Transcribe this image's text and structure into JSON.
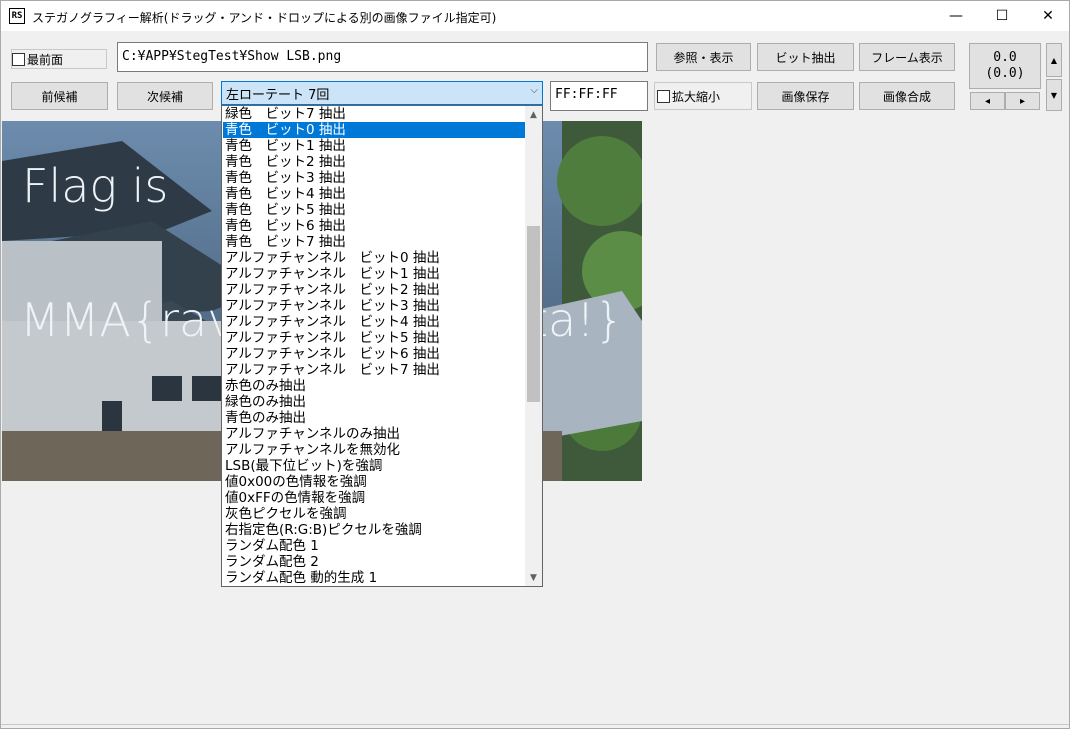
{
  "window": {
    "app_icon_text": "RS",
    "title": "ステガノグラフィー解析(ドラッグ・アンド・ドロップによる別の画像ファイル指定可)",
    "minimize": "—",
    "maximize": "☐",
    "close": "✕"
  },
  "toolbar": {
    "topmost_label": "最前面",
    "file_path": "C:¥APP¥StegTest¥Show LSB.png",
    "browse_button": "参照・表示",
    "bit_extract_button": "ビット抽出",
    "frame_display_button": "フレーム表示",
    "prev_button": "前候補",
    "next_button": "次候補",
    "mode_selected": "左ローテート 7回",
    "color_value": "FF:FF:FF",
    "zoom_label": "拡大縮小",
    "save_image_button": "画像保存",
    "composite_button": "画像合成",
    "coord_line1": "0.0",
    "coord_line2": "(0.0)",
    "up_arrow": "▲",
    "down_arrow": "▼",
    "left_arrow": "◂",
    "right_arrow": "▸"
  },
  "image": {
    "line1": "Flag is",
    "line2_left": "MMA{rav",
    "line2_right": "ta!}"
  },
  "dropdown": {
    "items": [
      "緑色　ビット7 抽出",
      "青色　ビット0 抽出",
      "青色　ビット1 抽出",
      "青色　ビット2 抽出",
      "青色　ビット3 抽出",
      "青色　ビット4 抽出",
      "青色　ビット5 抽出",
      "青色　ビット6 抽出",
      "青色　ビット7 抽出",
      "アルファチャンネル　ビット0 抽出",
      "アルファチャンネル　ビット1 抽出",
      "アルファチャンネル　ビット2 抽出",
      "アルファチャンネル　ビット3 抽出",
      "アルファチャンネル　ビット4 抽出",
      "アルファチャンネル　ビット5 抽出",
      "アルファチャンネル　ビット6 抽出",
      "アルファチャンネル　ビット7 抽出",
      "赤色のみ抽出",
      "緑色のみ抽出",
      "青色のみ抽出",
      "アルファチャンネルのみ抽出",
      "アルファチャンネルを無効化",
      "LSB(最下位ビット)を強調",
      "値0x00の色情報を強調",
      "値0xFFの色情報を強調",
      "灰色ピクセルを強調",
      "右指定色(R:G:B)ピクセルを強調",
      "ランダム配色 1",
      "ランダム配色 2",
      "ランダム配色 動的生成 1"
    ],
    "selected_index": 1,
    "scroll_up": "▲",
    "scroll_down": "▼"
  },
  "colors": {
    "selection": "#0078d7",
    "combo_bg": "#cce4f7",
    "button_bg": "#e1e1e1"
  }
}
